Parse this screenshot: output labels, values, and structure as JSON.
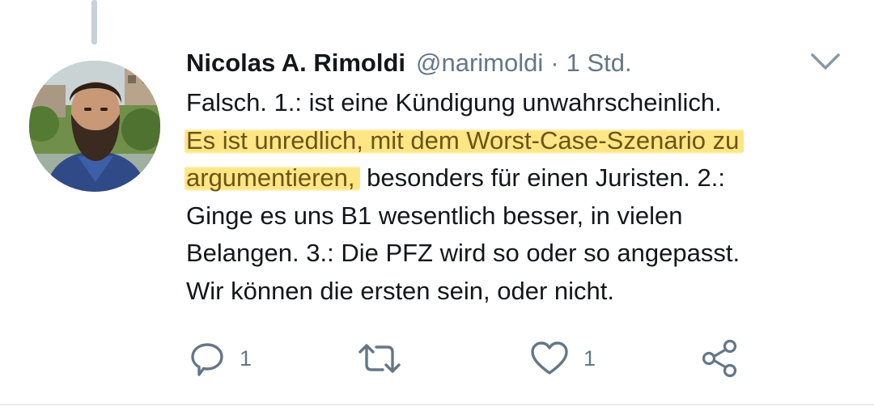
{
  "tweet": {
    "author_name": "Nicolas A. Rimoldi",
    "handle": "@narimoldi",
    "separator": "·",
    "timestamp": "1 Std.",
    "text_lines": [
      {
        "pre": "Falsch. 1.: ist eine Kündigung unwahrscheinlich.",
        "highlight": "",
        "post": ""
      },
      {
        "pre": "",
        "highlight": "Es ist unredlich, mit dem Worst-Case-Szenario zu",
        "post": ""
      },
      {
        "pre": "",
        "highlight": "argumentieren,",
        "post": " besonders für einen Juristen. 2.:"
      },
      {
        "pre": "Ginge es uns B1 wesentlich besser, in vielen",
        "highlight": "",
        "post": ""
      },
      {
        "pre": "Belangen. 3.: Die PFZ wird so oder so angepasst.",
        "highlight": "",
        "post": ""
      },
      {
        "pre": "Wir können die ersten sein, oder nicht.",
        "highlight": "",
        "post": ""
      }
    ],
    "highlight_color": "#fee26e"
  },
  "actions": {
    "reply": {
      "icon": "reply-icon",
      "count": "1"
    },
    "retweet": {
      "icon": "retweet-icon",
      "count": ""
    },
    "like": {
      "icon": "heart-icon",
      "count": "1"
    },
    "share": {
      "icon": "share-icon"
    }
  },
  "colors": {
    "text": "#14171a",
    "secondary": "#657786",
    "thread_line": "#c7d1d8",
    "divider": "#e6ecf0"
  }
}
